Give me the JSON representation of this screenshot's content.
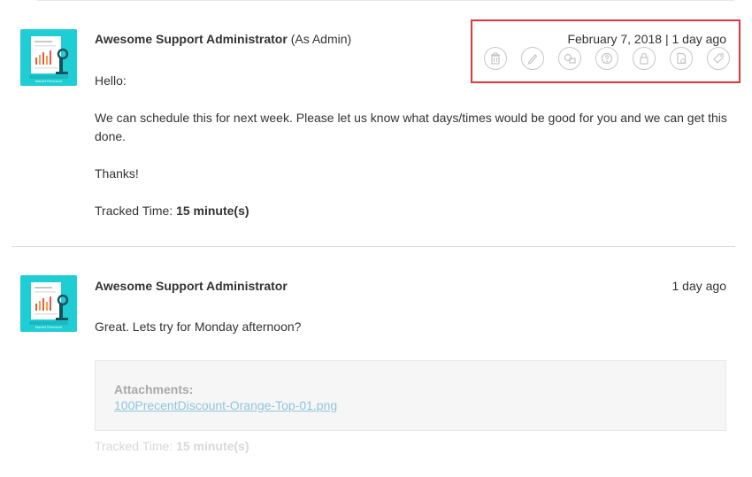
{
  "replies": [
    {
      "author": "Awesome Support Administrator",
      "role_suffix": "(As Admin)",
      "date": "February 7, 2018 | 1 day ago",
      "greeting": "Hello:",
      "paragraph": "We can schedule this for next week.  Please let us know what days/times would be good for you and we can get this done.",
      "signoff": "Thanks!",
      "tracked_label": "Tracked Time: ",
      "tracked_value": "15 minute(s)",
      "avatar_caption": "Market Research",
      "actions": [
        {
          "icon": "trash-icon"
        },
        {
          "icon": "edit-icon"
        },
        {
          "icon": "private-note-icon"
        },
        {
          "icon": "help-icon"
        },
        {
          "icon": "lock-icon"
        },
        {
          "icon": "copy-icon"
        },
        {
          "icon": "tag-icon"
        }
      ]
    },
    {
      "author": "Awesome Support Administrator",
      "date": "1 day ago",
      "message": "Great.  Lets try for Monday afternoon?",
      "attachments_label": "Attachments:",
      "attachment_file": "100PrecentDiscount-Orange-Top-01.png",
      "tracked_label": "Tracked Time: ",
      "tracked_value": "15 minute(s)",
      "avatar_caption": "Market Research"
    }
  ],
  "colors": {
    "avatar_bg": "#1fcdd5",
    "highlight_border": "#e0373d",
    "link": "#8ec6dd"
  }
}
